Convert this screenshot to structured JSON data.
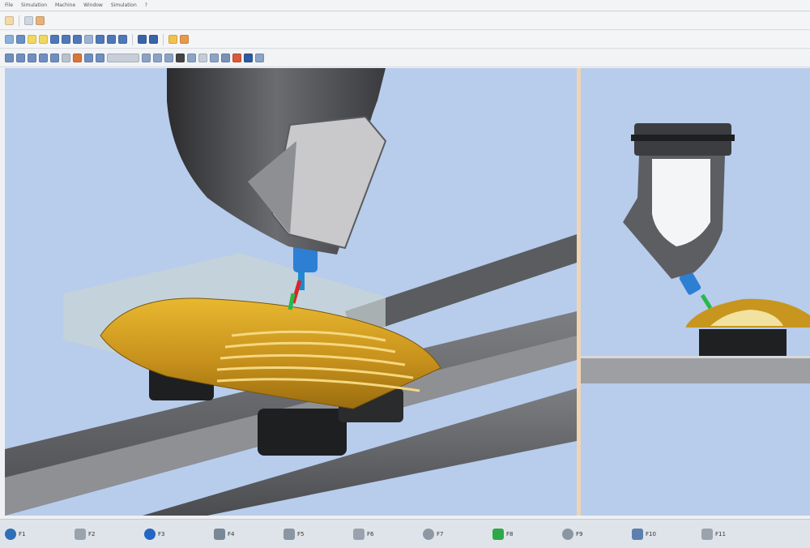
{
  "menu": {
    "items": [
      "File",
      "Simulation",
      "Machine",
      "Window",
      "Simulation",
      "?"
    ]
  },
  "statusbar": {
    "keys": [
      {
        "label": "F1",
        "icon": "help-icon",
        "color": "#2e6fb6"
      },
      {
        "label": "F2",
        "icon": "panel-icon",
        "color": "#9aa3ad"
      },
      {
        "label": "F3",
        "icon": "play-icon",
        "color": "#2366c4"
      },
      {
        "label": "F4",
        "icon": "edit-icon",
        "color": "#7a8796"
      },
      {
        "label": "F5",
        "icon": "tools-icon",
        "color": "#8b96a3"
      },
      {
        "label": "F6",
        "icon": "grid-icon",
        "color": "#9aa3ad"
      },
      {
        "label": "F7",
        "icon": "gear-icon",
        "color": "#8e98a4"
      },
      {
        "label": "F8",
        "icon": "green-square-icon",
        "color": "#2fa84a"
      },
      {
        "label": "F9",
        "icon": "zoom-icon",
        "color": "#8b96a3"
      },
      {
        "label": "F10",
        "icon": "window-icon",
        "color": "#5c7fb0"
      },
      {
        "label": "F11",
        "icon": "text-icon",
        "color": "#9aa3ad"
      }
    ]
  }
}
